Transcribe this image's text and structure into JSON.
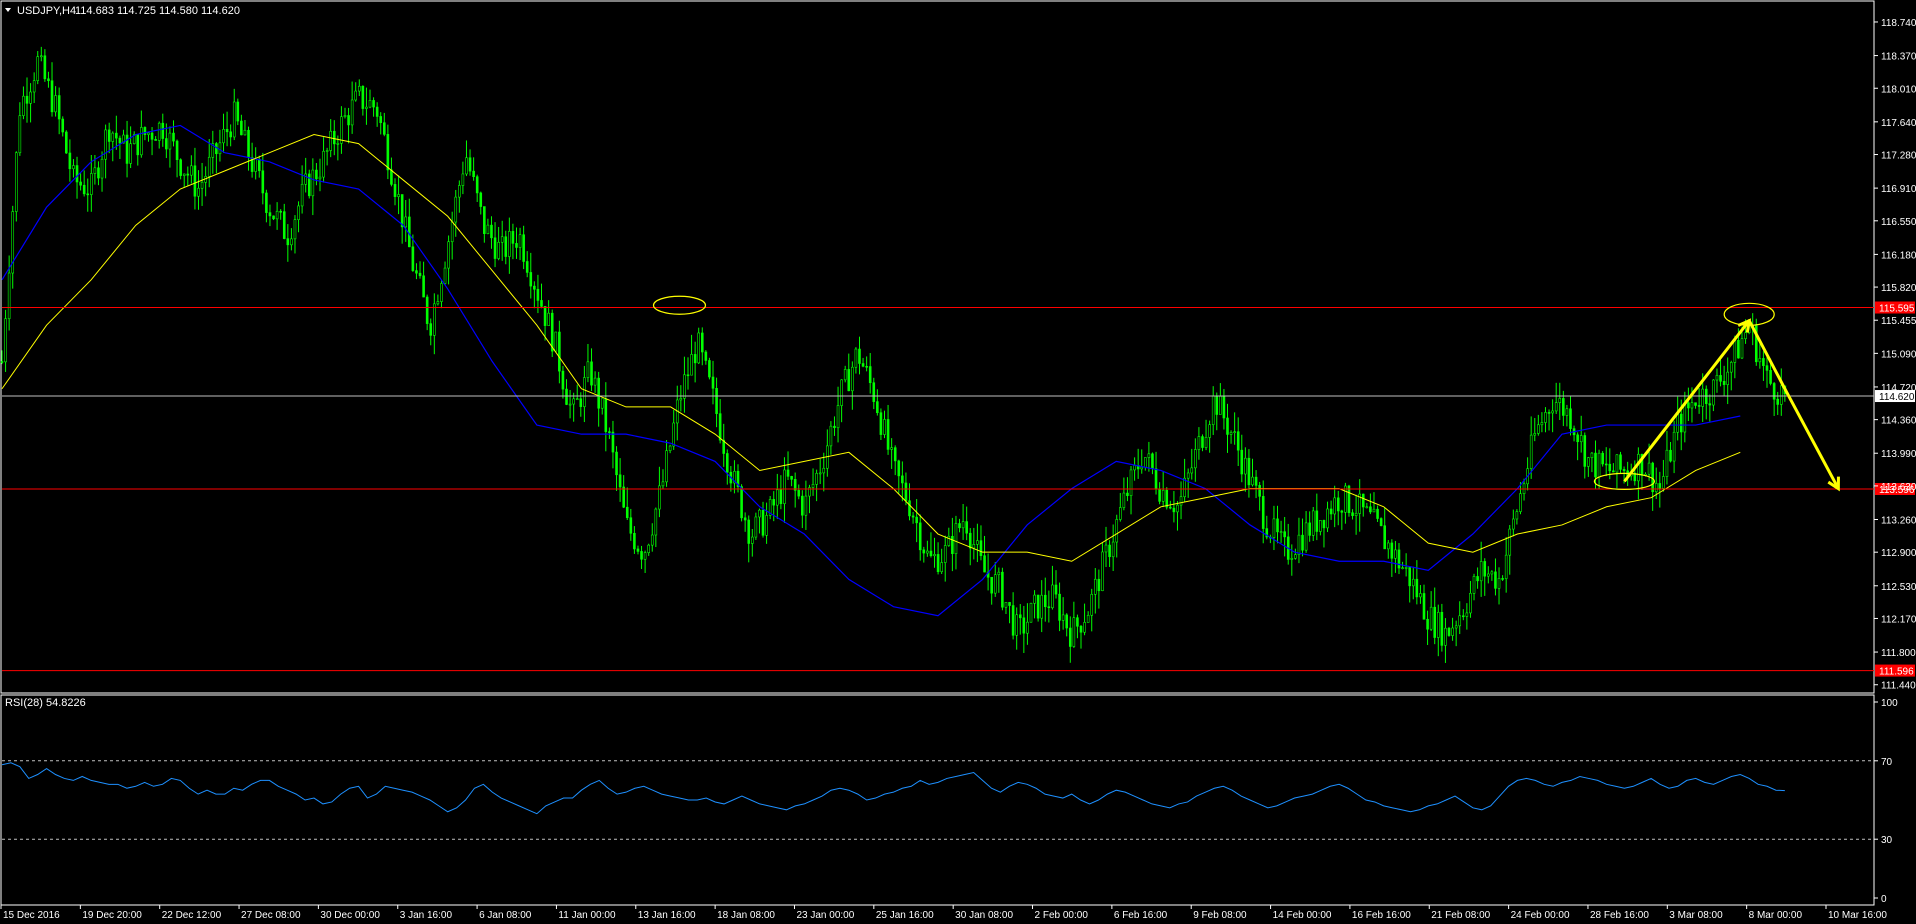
{
  "colors": {
    "background": "#000000",
    "frame": "#ffffff",
    "candle": "#00ff00",
    "fast_ma": "#ffff00",
    "slow_ma": "#0000ff",
    "annotation": "#ffff00",
    "level_line": "#ff0000",
    "price_line": "#c0c0c0",
    "rsi_line": "#1e90ff",
    "level_label_bg": "#ff0000",
    "text": "#ffffff"
  },
  "chart_data": [
    {
      "type": "candlestick",
      "title": "USDJPY,H4",
      "ohlc_readout": "114.683 114.725 114.580 114.620",
      "ylim": [
        111.36,
        118.96
      ],
      "y_ticks": [
        "118.740",
        "118.370",
        "118.010",
        "117.640",
        "117.280",
        "116.910",
        "116.550",
        "116.180",
        "115.820",
        "115.455",
        "115.090",
        "114.720",
        "114.360",
        "113.990",
        "113.630",
        "113.260",
        "112.900",
        "112.530",
        "112.170",
        "111.800",
        "111.440"
      ],
      "x_ticks": [
        "15 Dec 2016",
        "19 Dec 20:00",
        "22 Dec 12:00",
        "27 Dec 08:00",
        "30 Dec 00:00",
        "3 Jan 16:00",
        "6 Jan 08:00",
        "11 Jan 00:00",
        "13 Jan 16:00",
        "18 Jan 08:00",
        "23 Jan 00:00",
        "25 Jan 16:00",
        "30 Jan 08:00",
        "2 Feb 00:00",
        "6 Feb 16:00",
        "9 Feb 08:00",
        "14 Feb 00:00",
        "16 Feb 16:00",
        "21 Feb 08:00",
        "24 Feb 00:00",
        "28 Feb 16:00",
        "3 Mar 08:00",
        "8 Mar 00:00",
        "10 Mar 16:00"
      ],
      "close_path": [
        [
          0,
          115.0
        ],
        [
          2,
          117.8
        ],
        [
          4,
          118.3
        ],
        [
          6,
          117.8
        ],
        [
          8,
          117.0
        ],
        [
          10,
          116.9
        ],
        [
          12,
          117.6
        ],
        [
          14,
          117.3
        ],
        [
          16,
          117.5
        ],
        [
          18,
          117.6
        ],
        [
          20,
          117.2
        ],
        [
          22,
          116.9
        ],
        [
          24,
          117.3
        ],
        [
          26,
          117.7
        ],
        [
          28,
          117.2
        ],
        [
          30,
          116.7
        ],
        [
          32,
          116.4
        ],
        [
          34,
          116.9
        ],
        [
          36,
          117.2
        ],
        [
          38,
          117.6
        ],
        [
          40,
          117.9
        ],
        [
          42,
          117.8
        ],
        [
          44,
          117.0
        ],
        [
          46,
          116.1
        ],
        [
          48,
          115.4
        ],
        [
          50,
          116.3
        ],
        [
          52,
          117.3
        ],
        [
          54,
          116.5
        ],
        [
          56,
          116.2
        ],
        [
          58,
          116.4
        ],
        [
          60,
          115.8
        ],
        [
          62,
          115.2
        ],
        [
          64,
          114.4
        ],
        [
          66,
          114.9
        ],
        [
          68,
          114.2
        ],
        [
          70,
          113.2
        ],
        [
          72,
          112.9
        ],
        [
          74,
          113.6
        ],
        [
          76,
          114.6
        ],
        [
          78,
          115.2
        ],
        [
          80,
          114.5
        ],
        [
          82,
          113.7
        ],
        [
          84,
          113.1
        ],
        [
          86,
          113.3
        ],
        [
          88,
          113.7
        ],
        [
          90,
          113.4
        ],
        [
          92,
          113.9
        ],
        [
          94,
          114.6
        ],
        [
          96,
          115.1
        ],
        [
          98,
          114.6
        ],
        [
          100,
          113.8
        ],
        [
          102,
          113.4
        ],
        [
          104,
          112.8
        ],
        [
          106,
          112.9
        ],
        [
          108,
          113.3
        ],
        [
          110,
          112.7
        ],
        [
          112,
          112.5
        ],
        [
          114,
          112.0
        ],
        [
          116,
          112.3
        ],
        [
          118,
          112.4
        ],
        [
          120,
          112.0
        ],
        [
          122,
          112.3
        ],
        [
          124,
          112.9
        ],
        [
          126,
          113.5
        ],
        [
          128,
          114.0
        ],
        [
          130,
          113.6
        ],
        [
          132,
          113.4
        ],
        [
          134,
          114.0
        ],
        [
          136,
          114.6
        ],
        [
          138,
          114.2
        ],
        [
          140,
          113.7
        ],
        [
          142,
          113.2
        ],
        [
          144,
          112.9
        ],
        [
          146,
          113.1
        ],
        [
          148,
          113.3
        ],
        [
          150,
          113.5
        ],
        [
          152,
          113.4
        ],
        [
          154,
          113.2
        ],
        [
          156,
          112.9
        ],
        [
          158,
          112.6
        ],
        [
          160,
          112.2
        ],
        [
          162,
          112.0
        ],
        [
          164,
          112.3
        ],
        [
          166,
          112.7
        ],
        [
          168,
          112.6
        ],
        [
          170,
          113.4
        ],
        [
          172,
          114.2
        ],
        [
          174,
          114.6
        ],
        [
          176,
          114.4
        ],
        [
          178,
          113.9
        ],
        [
          180,
          113.8
        ],
        [
          182,
          113.8
        ],
        [
          184,
          113.9
        ],
        [
          186,
          113.6
        ],
        [
          188,
          114.3
        ],
        [
          190,
          114.6
        ],
        [
          192,
          114.7
        ],
        [
          194,
          115.0
        ],
        [
          196,
          115.4
        ],
        [
          198,
          114.8
        ],
        [
          200,
          114.62
        ]
      ],
      "fast_ma_path": [
        [
          0,
          114.7
        ],
        [
          5,
          115.4
        ],
        [
          10,
          115.9
        ],
        [
          15,
          116.5
        ],
        [
          20,
          116.9
        ],
        [
          25,
          117.1
        ],
        [
          30,
          117.3
        ],
        [
          35,
          117.5
        ],
        [
          40,
          117.4
        ],
        [
          45,
          117.0
        ],
        [
          50,
          116.6
        ],
        [
          55,
          116.0
        ],
        [
          60,
          115.4
        ],
        [
          65,
          114.7
        ],
        [
          70,
          114.5
        ],
        [
          75,
          114.5
        ],
        [
          80,
          114.2
        ],
        [
          85,
          113.8
        ],
        [
          90,
          113.9
        ],
        [
          95,
          114.0
        ],
        [
          100,
          113.6
        ],
        [
          105,
          113.1
        ],
        [
          110,
          112.9
        ],
        [
          115,
          112.9
        ],
        [
          120,
          112.8
        ],
        [
          125,
          113.1
        ],
        [
          130,
          113.4
        ],
        [
          135,
          113.5
        ],
        [
          140,
          113.6
        ],
        [
          145,
          113.6
        ],
        [
          150,
          113.6
        ],
        [
          155,
          113.4
        ],
        [
          160,
          113.0
        ],
        [
          165,
          112.9
        ],
        [
          170,
          113.1
        ],
        [
          175,
          113.2
        ],
        [
          180,
          113.4
        ],
        [
          185,
          113.5
        ],
        [
          190,
          113.8
        ],
        [
          195,
          114.0
        ]
      ],
      "slow_ma_path": [
        [
          0,
          115.9
        ],
        [
          5,
          116.7
        ],
        [
          10,
          117.2
        ],
        [
          15,
          117.5
        ],
        [
          20,
          117.6
        ],
        [
          25,
          117.3
        ],
        [
          30,
          117.2
        ],
        [
          35,
          117.0
        ],
        [
          40,
          116.9
        ],
        [
          45,
          116.5
        ],
        [
          50,
          115.8
        ],
        [
          55,
          115.0
        ],
        [
          60,
          114.3
        ],
        [
          65,
          114.2
        ],
        [
          70,
          114.2
        ],
        [
          75,
          114.1
        ],
        [
          80,
          113.9
        ],
        [
          85,
          113.4
        ],
        [
          90,
          113.1
        ],
        [
          95,
          112.6
        ],
        [
          100,
          112.3
        ],
        [
          105,
          112.2
        ],
        [
          110,
          112.6
        ],
        [
          115,
          113.2
        ],
        [
          120,
          113.6
        ],
        [
          125,
          113.9
        ],
        [
          130,
          113.8
        ],
        [
          135,
          113.6
        ],
        [
          140,
          113.2
        ],
        [
          145,
          112.9
        ],
        [
          150,
          112.8
        ],
        [
          155,
          112.8
        ],
        [
          160,
          112.7
        ],
        [
          165,
          113.1
        ],
        [
          170,
          113.6
        ],
        [
          175,
          114.2
        ],
        [
          180,
          114.3
        ],
        [
          185,
          114.3
        ],
        [
          190,
          114.3
        ],
        [
          195,
          114.4
        ]
      ],
      "horizontal_levels": [
        {
          "value": 115.595,
          "label": "115.595"
        },
        {
          "value": 113.596,
          "label": "113.596"
        },
        {
          "value": 111.596,
          "label": "111.596"
        }
      ],
      "current_price": {
        "value": 114.62,
        "label": "114.620"
      },
      "annotations": {
        "ellipses": [
          {
            "x": 76,
            "y": 115.62
          },
          {
            "x": 182,
            "y": 113.68
          },
          {
            "x": 196,
            "y": 115.52
          }
        ],
        "forecast_path": [
          [
            182,
            113.68
          ],
          [
            196,
            115.45
          ],
          [
            200,
            114.7
          ],
          [
            206,
            113.6
          ]
        ]
      }
    },
    {
      "type": "line",
      "title": "RSI(28) 54.8226",
      "ylim": [
        0,
        100
      ],
      "y_ticks": [
        "100",
        "70",
        "30",
        "0"
      ],
      "levels": [
        70,
        30
      ],
      "x_end": 200,
      "values": [
        68,
        69,
        67,
        61,
        63,
        66,
        63,
        61,
        60,
        62,
        60,
        59,
        58,
        58,
        56,
        57,
        59,
        57,
        58,
        61,
        60,
        56,
        53,
        55,
        53,
        53,
        56,
        55,
        58,
        60,
        60,
        57,
        55,
        53,
        50,
        51,
        48,
        49,
        53,
        56,
        57,
        51,
        53,
        57,
        56,
        55,
        54,
        52,
        50,
        47,
        44,
        46,
        50,
        56,
        58,
        54,
        51,
        49,
        47,
        45,
        43,
        47,
        49,
        51,
        51,
        55,
        58,
        60,
        56,
        53,
        54,
        56,
        57,
        55,
        53,
        52,
        51,
        50,
        50,
        51,
        49,
        48,
        50,
        52,
        50,
        48,
        47,
        46,
        45,
        47,
        48,
        50,
        52,
        55,
        56,
        55,
        53,
        50,
        51,
        53,
        54,
        56,
        57,
        60,
        58,
        59,
        61,
        62,
        63,
        64,
        60,
        56,
        54,
        57,
        59,
        58,
        56,
        53,
        52,
        51,
        53,
        50,
        48,
        50,
        53,
        55,
        54,
        52,
        50,
        48,
        47,
        46,
        48,
        49,
        52,
        54,
        56,
        57,
        55,
        52,
        50,
        48,
        46,
        47,
        49,
        51,
        52,
        53,
        55,
        57,
        58,
        56,
        53,
        50,
        49,
        47,
        46,
        45,
        44,
        45,
        47,
        48,
        50,
        52,
        49,
        46,
        45,
        47,
        52,
        57,
        60,
        61,
        60,
        58,
        57,
        59,
        60,
        62,
        61,
        60,
        58,
        57,
        56,
        57,
        59,
        61,
        58,
        56,
        57,
        60,
        61,
        59,
        58,
        60,
        62,
        63,
        61,
        58,
        57,
        55,
        54.8
      ]
    }
  ]
}
